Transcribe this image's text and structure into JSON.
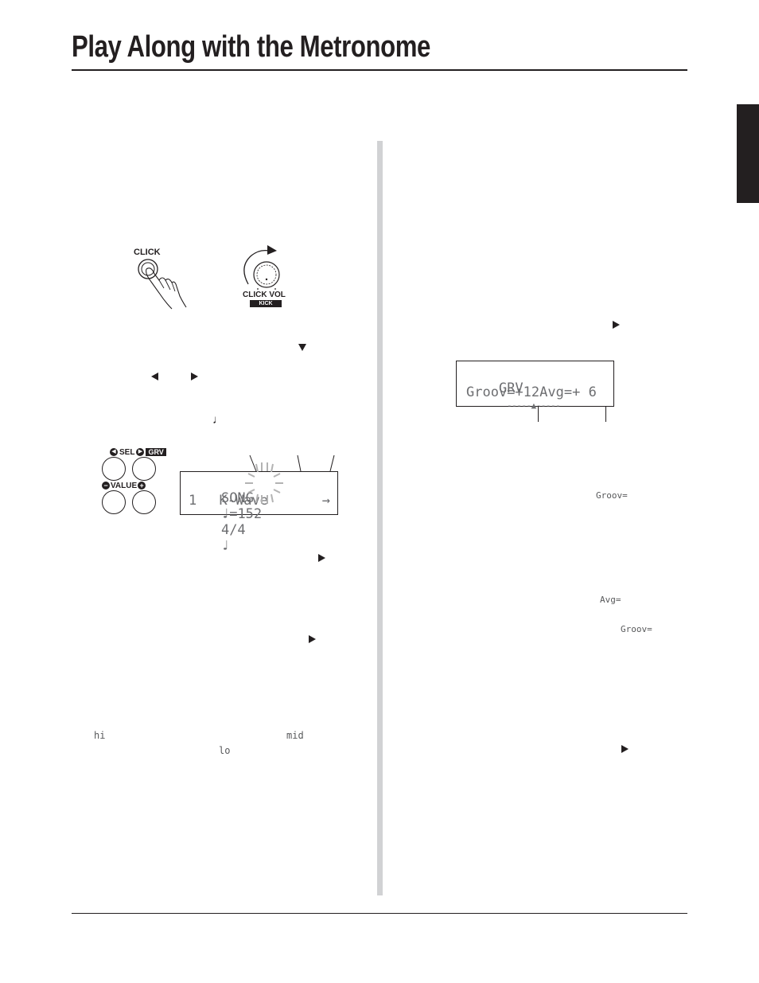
{
  "page": {
    "title": "Play Along with the Metronome"
  },
  "figures": {
    "click_button": {
      "label": "CLICK",
      "icon": "hand-pressing-button"
    },
    "click_vol_knob": {
      "label": "CLICK VOL",
      "sub_label": "KICK",
      "icon": "rotary-knob-clockwise"
    },
    "sel_value_buttons": {
      "sel_label": "SEL",
      "grv_tag": "GRV",
      "value_label": "VALUE",
      "minus_symbol": "−",
      "plus_symbol": "+"
    },
    "song_lcd": {
      "line1": {
        "mode": "SONG",
        "tempo_note": "♩=",
        "tempo": "152",
        "time_signature": "4/4",
        "click_note": "♩"
      },
      "line2": {
        "song_number": "1",
        "song_name": "K-Wave",
        "arrow": "→"
      }
    },
    "grv_lcd": {
      "line1": {
        "label": "GRV",
        "meter": "-----▲-----"
      },
      "line2": {
        "groov_label": "Groov=",
        "groov_value": "+12",
        "avg_label": "Avg=",
        "avg_value": "+ 6"
      }
    }
  },
  "inline_glyphs": {
    "left_col": {
      "down_arrow": "▼",
      "left_arrow": "◀",
      "right_arrow": "▶",
      "quarter_note": "♩",
      "right_arrow_2": "▶",
      "right_arrow_3": "▶",
      "hi": "hi",
      "mid": "mid",
      "lo": "lo"
    },
    "right_col": {
      "right_arrow_1": "▶",
      "groov_1": "Groov=",
      "avg": "Avg=",
      "groov_2": "Groov=",
      "right_arrow_2": "▶"
    }
  }
}
